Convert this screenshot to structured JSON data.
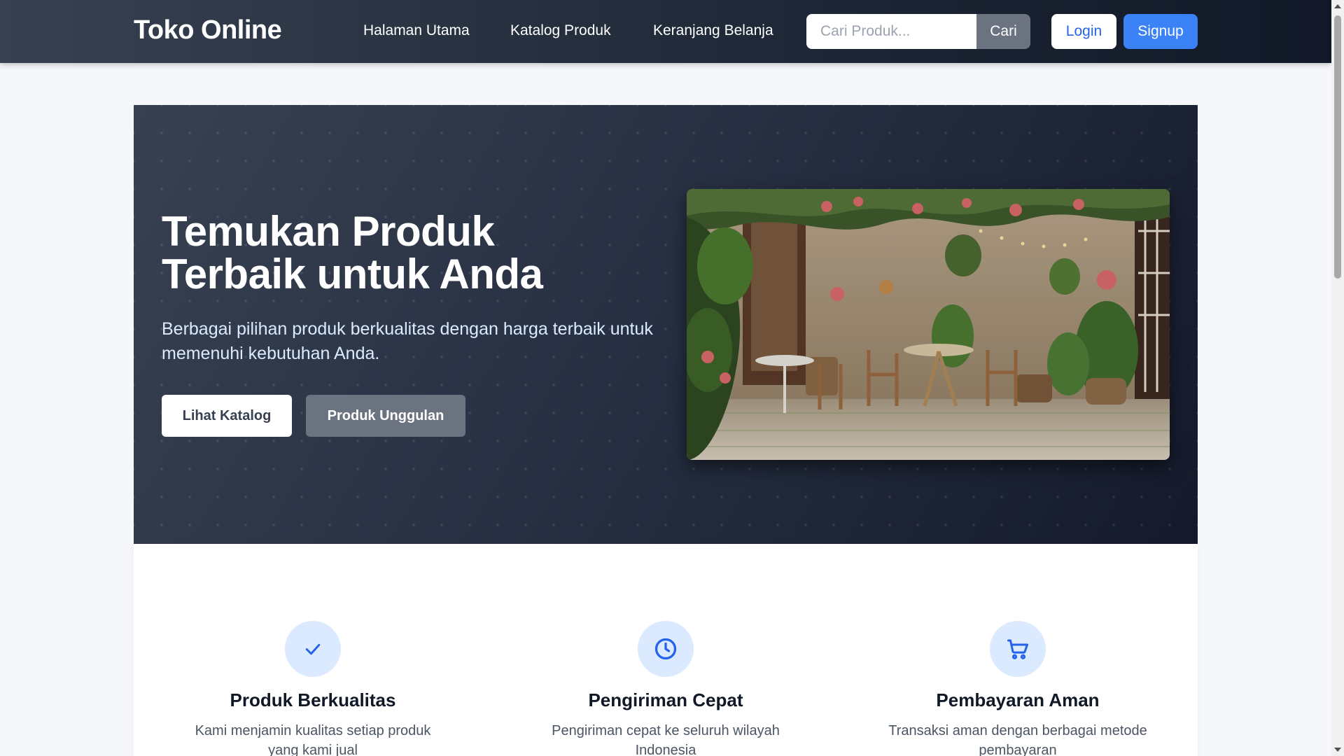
{
  "nav": {
    "brand": "Toko Online",
    "links": [
      "Halaman Utama",
      "Katalog Produk",
      "Keranjang Belanja"
    ],
    "search": {
      "placeholder": "Cari Produk...",
      "button": "Cari"
    },
    "login": "Login",
    "signup": "Signup"
  },
  "hero": {
    "title_line1": "Temukan Produk",
    "title_line2": "Terbaik untuk Anda",
    "description": "Berbagai pilihan produk berkualitas dengan harga terbaik untuk memenuhi kebutuhan Anda.",
    "btn_catalog": "Lihat Katalog",
    "btn_featured": "Produk Unggulan"
  },
  "features": [
    {
      "icon": "check-icon",
      "title": "Produk Berkualitas",
      "desc": "Kami menjamin kualitas setiap produk yang kami jual"
    },
    {
      "icon": "clock-icon",
      "title": "Pengiriman Cepat",
      "desc": "Pengiriman cepat ke seluruh wilayah Indonesia"
    },
    {
      "icon": "cart-icon",
      "title": "Pembayaran Aman",
      "desc": "Transaksi aman dengan berbagai metode pembayaran"
    }
  ],
  "colors": {
    "primary": "#3b82f6",
    "nav_dark": "#1f2937",
    "icon_circle": "#dbeafe",
    "icon_stroke": "#2563eb"
  }
}
